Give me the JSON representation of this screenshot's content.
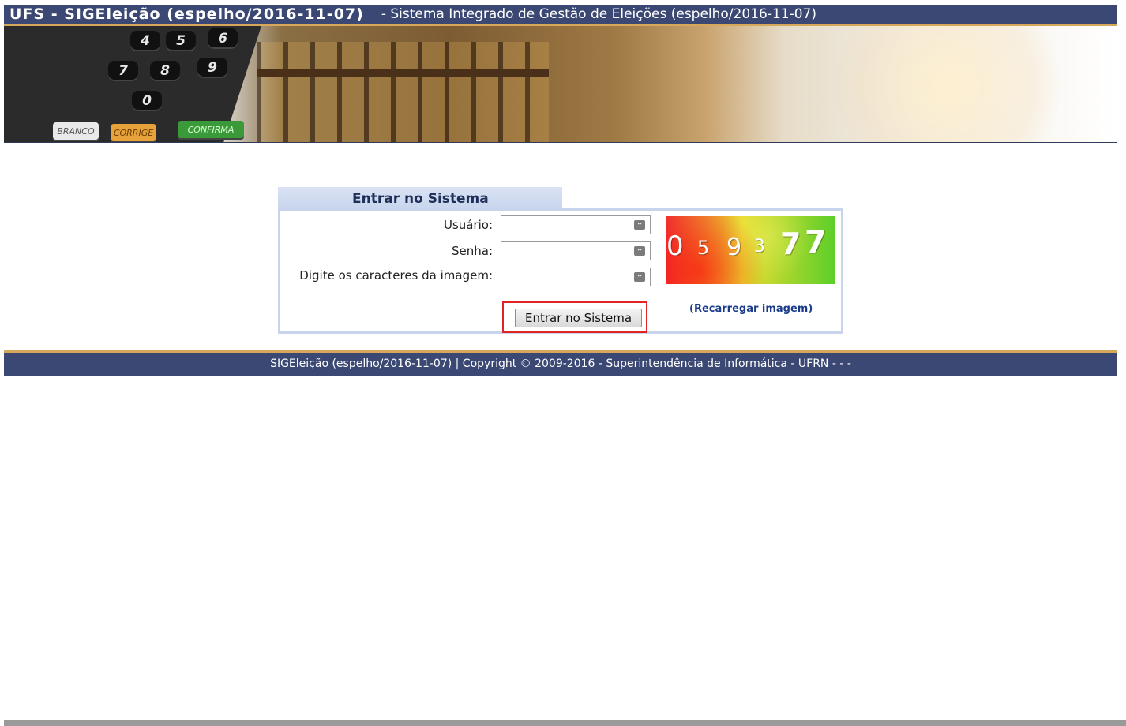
{
  "header": {
    "title": "UFS - SIGEleição (espelho/2016-11-07)",
    "subtitle": "- Sistema Integrado de Gestão de Eleições (espelho/2016-11-07)"
  },
  "banner": {
    "keys": [
      "4",
      "5",
      "6",
      "7",
      "8",
      "9",
      "0"
    ],
    "buttons": [
      "BRANCO",
      "CORRIGE",
      "CONFIRMA"
    ]
  },
  "login": {
    "tab_title": "Entrar no Sistema",
    "username_label": "Usuário:",
    "password_label": "Senha:",
    "captcha_label": "Digite os caracteres da imagem:",
    "username_value": "",
    "password_value": "",
    "captcha_value": "",
    "captcha_digits": [
      "0",
      "5",
      "9",
      "3",
      "7",
      "7"
    ],
    "submit_label": "Entrar no Sistema",
    "reload_label": "(Recarregar imagem)"
  },
  "footer": {
    "text": "SIGEleição (espelho/2016-11-07) | Copyright © 2009-2016 - Superintendência de Informática - UFRN - - -"
  },
  "colors": {
    "header_bg": "#3a4873",
    "accent_line": "#d8a85a",
    "tab_bg": "#c7d4ec",
    "highlight": "#e02424",
    "link": "#1b3c8c"
  }
}
